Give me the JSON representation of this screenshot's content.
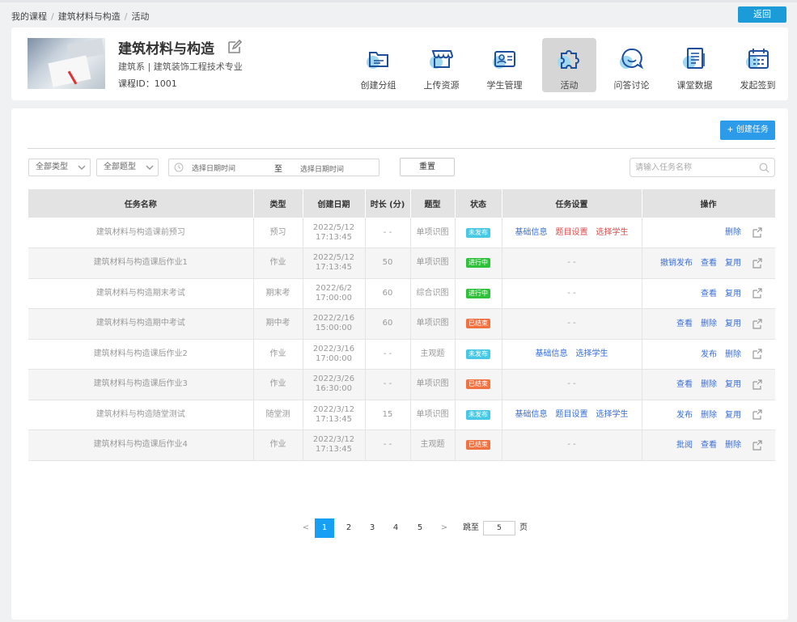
{
  "breadcrumb": [
    "我的课程",
    "建筑材料与构造",
    "活动"
  ],
  "back_label": "返回",
  "course": {
    "title": "建筑材料与构造",
    "dept": "建筑系 | 建筑装饰工程技术专业",
    "id": "课程ID：1001"
  },
  "nav": [
    {
      "label": "创建分组",
      "icon": "folder-icon"
    },
    {
      "label": "上传资源",
      "icon": "store-icon"
    },
    {
      "label": "学生管理",
      "icon": "id-card-icon"
    },
    {
      "label": "活动",
      "icon": "puzzle-icon",
      "active": true
    },
    {
      "label": "问答讨论",
      "icon": "chat-icon"
    },
    {
      "label": "课堂数据",
      "icon": "document-icon"
    },
    {
      "label": "发起签到",
      "icon": "calendar-icon"
    }
  ],
  "create_task_label": "+ 创建任务",
  "filters": {
    "type_select": "全部类型",
    "question_select": "全部题型",
    "date_start": "选择日期时间",
    "date_to": "至",
    "date_end": "选择日期时间",
    "reset": "重置",
    "search_placeholder": "请输入任务名称"
  },
  "table": {
    "headers": [
      "任务名称",
      "类型",
      "创建日期",
      "时长 (分)",
      "题型",
      "状态",
      "任务设置",
      "操作"
    ],
    "rows": [
      {
        "name": "建筑材料与构造课前预习",
        "type": "预习",
        "date": "2022/5/12",
        "time": "17:13:45",
        "duration": "- -",
        "qtype": "单项识图",
        "status": "未发布",
        "status_color": "#47c9e5",
        "settings": [
          {
            "t": "基础信息",
            "c": "blue"
          },
          {
            "t": "题目设置",
            "c": "red"
          },
          {
            "t": "选择学生",
            "c": "red"
          }
        ],
        "ops": [
          "删除"
        ]
      },
      {
        "name": "建筑材料与构造课后作业1",
        "type": "作业",
        "date": "2022/5/12",
        "time": "17:13:45",
        "duration": "50",
        "qtype": "单项识图",
        "status": "进行中",
        "status_color": "#2fc13a",
        "settings": [
          {
            "t": "- -",
            "c": "dash"
          }
        ],
        "ops": [
          "撤销发布",
          "查看",
          "复用"
        ]
      },
      {
        "name": "建筑材料与构造期末考试",
        "type": "期末考",
        "date": "2022/6/2",
        "time": "17:00:00",
        "duration": "60",
        "qtype": "综合识图",
        "status": "进行中",
        "status_color": "#2fc13a",
        "settings": [
          {
            "t": "- -",
            "c": "dash"
          }
        ],
        "ops": [
          "查看",
          "复用"
        ]
      },
      {
        "name": "建筑材料与构造期中考试",
        "type": "期中考",
        "date": "2022/2/16",
        "time": "15:00:00",
        "duration": "60",
        "qtype": "单项识图",
        "status": "已结束",
        "status_color": "#f27140",
        "settings": [
          {
            "t": "- -",
            "c": "dash"
          }
        ],
        "ops": [
          "查看",
          "删除",
          "复用"
        ]
      },
      {
        "name": "建筑材料与构造课后作业2",
        "type": "作业",
        "date": "2022/3/16",
        "time": "17:00:00",
        "duration": "- -",
        "qtype": "主观题",
        "status": "未发布",
        "status_color": "#47c9e5",
        "settings": [
          {
            "t": "基础信息",
            "c": "blue"
          },
          {
            "t": "选择学生",
            "c": "blue"
          }
        ],
        "ops": [
          "发布",
          "删除"
        ]
      },
      {
        "name": "建筑材料与构造课后作业3",
        "type": "作业",
        "date": "2022/3/26",
        "time": "16:30:00",
        "duration": "- -",
        "qtype": "单项识图",
        "status": "已结束",
        "status_color": "#f27140",
        "settings": [
          {
            "t": "- -",
            "c": "dash"
          }
        ],
        "ops": [
          "查看",
          "删除",
          "复用"
        ]
      },
      {
        "name": "建筑材料与构造随堂测试",
        "type": "随堂测",
        "date": "2022/3/12",
        "time": "17:13:45",
        "duration": "15",
        "qtype": "单项识图",
        "status": "未发布",
        "status_color": "#47c9e5",
        "settings": [
          {
            "t": "基础信息",
            "c": "blue"
          },
          {
            "t": "题目设置",
            "c": "blue"
          },
          {
            "t": "选择学生",
            "c": "blue"
          }
        ],
        "ops": [
          "发布",
          "删除",
          "复用"
        ]
      },
      {
        "name": "建筑材料与构造课后作业4",
        "type": "作业",
        "date": "2022/3/12",
        "time": "17:13:45",
        "duration": "- -",
        "qtype": "主观题",
        "status": "已结束",
        "status_color": "#f27140",
        "settings": [
          {
            "t": "- -",
            "c": "dash"
          }
        ],
        "ops": [
          "批阅",
          "查看",
          "删除"
        ]
      }
    ]
  },
  "pager": {
    "prev": "<",
    "pages": [
      "1",
      "2",
      "3",
      "4",
      "5"
    ],
    "current": 1,
    "next": ">",
    "jump_label": "跳至",
    "jump_value": "5",
    "page_label": "页"
  }
}
